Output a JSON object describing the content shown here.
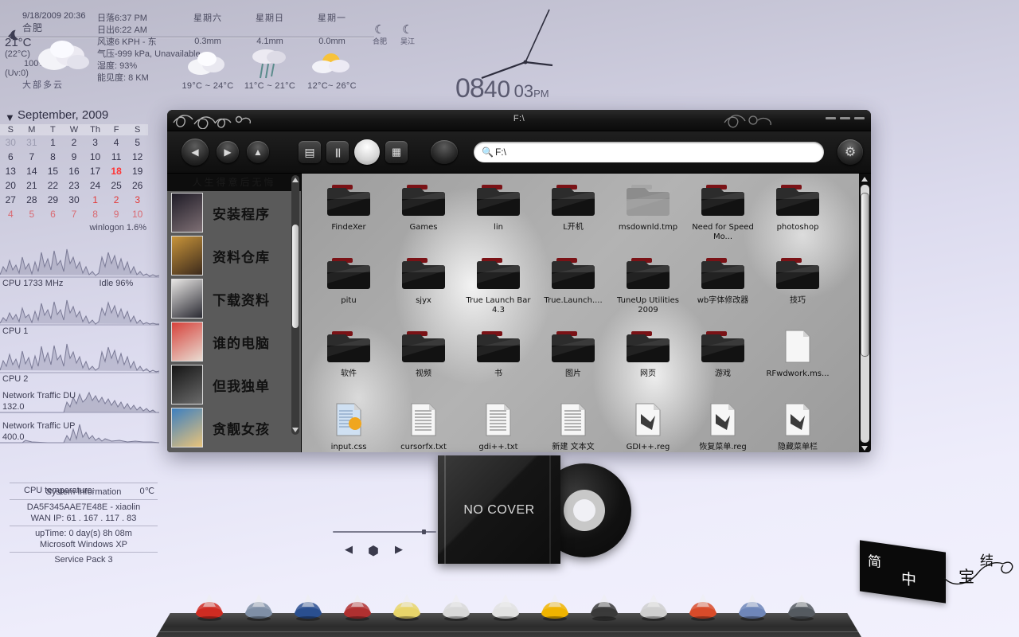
{
  "desktop": {
    "background_colors": {
      "top": "#b9b8c8",
      "bottom": "#f2f1fd"
    }
  },
  "weather": {
    "icon": "moon-cloud-icon",
    "datetime": "9/18/2009 20:36",
    "city": "合肥",
    "temp": "21°C",
    "feels_like": "(22°C)",
    "humidity_pct": "100%",
    "uv": "(Uv:0)",
    "description": "大部多云",
    "details": [
      "日落6:37 PM",
      "日出6:22 AM",
      "风速6 KPH - 东",
      "气压-999 kPa, Unavailable",
      "湿度: 93%",
      "能见度: 8 KM"
    ],
    "forecast": [
      {
        "day": "星期六",
        "precip": "0.3mm",
        "icon": "cloudy-icon",
        "range": "19°C ~ 24°C"
      },
      {
        "day": "星期日",
        "precip": "4.1mm",
        "icon": "rain-icon",
        "range": "11°C ~ 21°C"
      },
      {
        "day": "星期一",
        "precip": "0.0mm",
        "icon": "sun-cloud-icon",
        "range": "12°C~ 26°C"
      }
    ],
    "mini": [
      {
        "icon": "moon-cloud-icon",
        "label": "合肥"
      },
      {
        "icon": "moon-cloud-icon",
        "label": "吴江"
      }
    ]
  },
  "calendar": {
    "arrow_icon": "chevron-down-icon",
    "title": "September, 2009",
    "weekdays": [
      "S",
      "M",
      "T",
      "W",
      "Th",
      "F",
      "S"
    ],
    "weeks": [
      [
        {
          "d": "30",
          "c": "dim"
        },
        {
          "d": "31",
          "c": "dim"
        },
        {
          "d": "1",
          "c": ""
        },
        {
          "d": "2",
          "c": ""
        },
        {
          "d": "3",
          "c": ""
        },
        {
          "d": "4",
          "c": ""
        },
        {
          "d": "5",
          "c": ""
        }
      ],
      [
        {
          "d": "6",
          "c": ""
        },
        {
          "d": "7",
          "c": ""
        },
        {
          "d": "8",
          "c": ""
        },
        {
          "d": "9",
          "c": ""
        },
        {
          "d": "10",
          "c": ""
        },
        {
          "d": "11",
          "c": ""
        },
        {
          "d": "12",
          "c": ""
        }
      ],
      [
        {
          "d": "13",
          "c": ""
        },
        {
          "d": "14",
          "c": ""
        },
        {
          "d": "15",
          "c": ""
        },
        {
          "d": "16",
          "c": ""
        },
        {
          "d": "17",
          "c": ""
        },
        {
          "d": "18",
          "c": "today"
        },
        {
          "d": "19",
          "c": ""
        }
      ],
      [
        {
          "d": "20",
          "c": ""
        },
        {
          "d": "21",
          "c": ""
        },
        {
          "d": "22",
          "c": ""
        },
        {
          "d": "23",
          "c": ""
        },
        {
          "d": "24",
          "c": ""
        },
        {
          "d": "25",
          "c": ""
        },
        {
          "d": "26",
          "c": ""
        }
      ],
      [
        {
          "d": "27",
          "c": ""
        },
        {
          "d": "28",
          "c": ""
        },
        {
          "d": "29",
          "c": ""
        },
        {
          "d": "30",
          "c": ""
        },
        {
          "d": "1",
          "c": "red"
        },
        {
          "d": "2",
          "c": "red"
        },
        {
          "d": "3",
          "c": "red"
        }
      ],
      [
        {
          "d": "4",
          "c": "pink"
        },
        {
          "d": "5",
          "c": "pink"
        },
        {
          "d": "6",
          "c": "pink"
        },
        {
          "d": "7",
          "c": "pink"
        },
        {
          "d": "8",
          "c": "pink"
        },
        {
          "d": "9",
          "c": "pink"
        },
        {
          "d": "10",
          "c": "pink"
        }
      ]
    ],
    "footer": "winlogon 1.6%"
  },
  "monitors": [
    {
      "name": "cpu-total",
      "label": "CPU 1733 MHz",
      "value": "Idle 96%"
    },
    {
      "name": "cpu-1",
      "label": "CPU 1",
      "value": ""
    },
    {
      "name": "cpu-2",
      "label": "CPU 2",
      "value": ""
    },
    {
      "name": "net-down",
      "label": "Network Traffic DU",
      "value": "132.0"
    },
    {
      "name": "net-up",
      "label": "Network Traffic UP",
      "value": "400.0"
    }
  ],
  "sysinfo": {
    "cpu_temp_label": "CPU temperature:",
    "cpu_temp_value": "0℃",
    "heading": "System Information",
    "machine": "DA5F345AAE7E48E - xiaolin",
    "wan_ip": "WAN IP: 61 . 167 . 117 . 83",
    "uptime": "upTime: 0 day(s) 8h 08m",
    "os": "Microsoft Windows XP",
    "service_pack": "Service Pack 3"
  },
  "clock": {
    "hours": "08",
    "minutes": "40",
    "seconds": "03",
    "ampm": "PM"
  },
  "explorer": {
    "title": "F:\\",
    "nav": [
      {
        "name": "back-button",
        "glyph": "◀"
      },
      {
        "name": "forward-button",
        "glyph": "▶"
      },
      {
        "name": "up-button",
        "glyph": "▲"
      }
    ],
    "views": [
      {
        "name": "list-view-button",
        "glyph": "▤"
      },
      {
        "name": "column-view-button",
        "glyph": "|||"
      },
      {
        "name": "coverflow-view-button",
        "glyph": ""
      },
      {
        "name": "icon-view-button",
        "glyph": "▦"
      }
    ],
    "action_button": "action-button",
    "search": {
      "icon": "search-icon",
      "value": "F:\\",
      "placeholder": "F:\\"
    },
    "settings_button_label": "⚙",
    "window_buttons": [
      "minimize",
      "maximize",
      "close"
    ],
    "sidebar": {
      "header": "人生得意后无悔",
      "items": [
        {
          "label": "安装程序",
          "thumb": "photo-thumb-1"
        },
        {
          "label": "资料仓库",
          "thumb": "photo-thumb-2"
        },
        {
          "label": "下载资料",
          "thumb": "photo-thumb-3"
        },
        {
          "label": "谁的电脑",
          "thumb": "photo-thumb-4"
        },
        {
          "label": "但我独单",
          "thumb": "photo-thumb-5"
        },
        {
          "label": "贪靓女孩",
          "thumb": "photo-thumb-6"
        }
      ]
    },
    "files": [
      {
        "name": "FindeXer",
        "type": "folder"
      },
      {
        "name": "Games",
        "type": "folder"
      },
      {
        "name": "lin",
        "type": "folder"
      },
      {
        "name": "L开机",
        "type": "folder"
      },
      {
        "name": "msdownld.tmp",
        "type": "folder-dim"
      },
      {
        "name": "Need for Speed Mo...",
        "type": "folder"
      },
      {
        "name": "photoshop",
        "type": "folder"
      },
      {
        "name": "pitu",
        "type": "folder"
      },
      {
        "name": "sjyx",
        "type": "folder"
      },
      {
        "name": "True Launch Bar 4.3",
        "type": "folder"
      },
      {
        "name": "True.Launch....",
        "type": "folder"
      },
      {
        "name": "TuneUp Utilities 2009",
        "type": "folder"
      },
      {
        "name": "wb字体修改器",
        "type": "folder"
      },
      {
        "name": "技巧",
        "type": "folder"
      },
      {
        "name": "软件",
        "type": "folder"
      },
      {
        "name": "视频",
        "type": "folder"
      },
      {
        "name": "书",
        "type": "folder"
      },
      {
        "name": "图片",
        "type": "folder"
      },
      {
        "name": "网页",
        "type": "folder"
      },
      {
        "name": "游戏",
        "type": "folder"
      },
      {
        "name": "RFwdwork.ms...",
        "type": "doc-blank"
      },
      {
        "name": "input.css",
        "type": "doc-css"
      },
      {
        "name": "cursorfx.txt",
        "type": "doc-text"
      },
      {
        "name": "gdi++.txt",
        "type": "doc-text"
      },
      {
        "name": "新建 文本文",
        "type": "doc-text"
      },
      {
        "name": "GDI++.reg",
        "type": "doc-reg"
      },
      {
        "name": "恢复菜单.reg",
        "type": "doc-reg"
      },
      {
        "name": "隐藏菜单栏",
        "type": "doc-reg"
      }
    ]
  },
  "player": {
    "cover_text": "NO COVER",
    "prev_glyph": "◀",
    "stop_glyph": "⬢",
    "next_glyph": "▶"
  },
  "dock": {
    "icons": [
      {
        "name": "dock-icon-cars",
        "glyph": "🚗"
      },
      {
        "name": "dock-icon-jet",
        "glyph": "✈"
      },
      {
        "name": "dock-icon-motorbike-blue",
        "glyph": "🏍"
      },
      {
        "name": "dock-icon-motorbike-red",
        "glyph": "🏍"
      },
      {
        "name": "dock-icon-starship-yellow",
        "glyph": "🚀"
      },
      {
        "name": "dock-icon-sportscar-white",
        "glyph": "🏎"
      },
      {
        "name": "dock-icon-falcon",
        "glyph": "🛸"
      },
      {
        "name": "dock-icon-motorbike-yellow",
        "glyph": "🏍"
      },
      {
        "name": "dock-icon-tie-fighter",
        "glyph": "✖"
      },
      {
        "name": "dock-icon-racecar-white",
        "glyph": "🏎"
      },
      {
        "name": "dock-icon-naboo-fighter",
        "glyph": "🚀"
      },
      {
        "name": "dock-icon-snowspeeder",
        "glyph": "🛩"
      },
      {
        "name": "dock-icon-droid",
        "glyph": "🤖"
      }
    ]
  },
  "desk_tag": {
    "char_top": "简",
    "char_bottom": "中",
    "knot_char": "宝",
    "knot_char2": "结"
  }
}
